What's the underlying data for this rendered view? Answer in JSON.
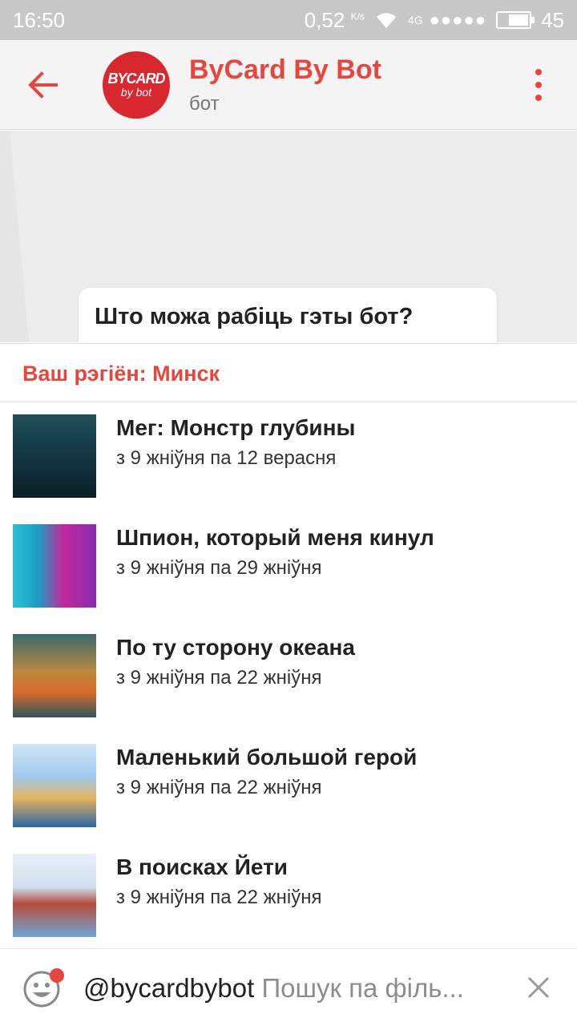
{
  "status_bar": {
    "time": "16:50",
    "speed_value": "0,52",
    "speed_unit": "K/s",
    "network": "4G",
    "signal_dots": "●●●●●",
    "battery": "45"
  },
  "header": {
    "avatar_line1": "BYCARD",
    "avatar_line2": "by bot",
    "title": "ByCard By Bot",
    "subtitle": "бот"
  },
  "chat": {
    "message": "Што можа рабіць гэты бот?"
  },
  "region": {
    "label": "Ваш рэгіён: Минск"
  },
  "movies": [
    {
      "title": "Мег: Монстр глубины",
      "dates": "з 9 жніўня па 12 верасня"
    },
    {
      "title": "Шпион, который меня кинул",
      "dates": "з 9 жніўня па 29 жніўня"
    },
    {
      "title": "По ту сторону океана",
      "dates": "з 9 жніўня па 22 жніўня"
    },
    {
      "title": "Маленький большой герой",
      "dates": "з 9 жніўня па 22 жніўня"
    },
    {
      "title": "В поисках Йети",
      "dates": "з 9 жніўня па 22 жніўня"
    }
  ],
  "input": {
    "bot_handle": "@bycardbybot",
    "placeholder": "Пошук па філь..."
  },
  "colors": {
    "accent": "#e8453c",
    "avatar": "#d8282d",
    "status_bar": "#c8c8c8",
    "chat_bg": "#ececec"
  },
  "icons": {
    "back": "arrow-left-icon",
    "menu": "more-vertical-icon",
    "emoji": "emoji-smile-icon",
    "clear": "close-icon",
    "wifi": "wifi-icon",
    "battery": "battery-icon"
  }
}
